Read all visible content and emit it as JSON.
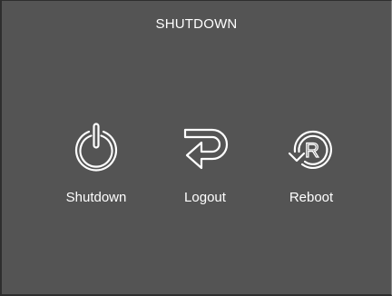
{
  "dialog": {
    "title": "SHUTDOWN"
  },
  "options": [
    {
      "label": "Shutdown",
      "icon": "power-icon"
    },
    {
      "label": "Logout",
      "icon": "logout-icon"
    },
    {
      "label": "Reboot",
      "icon": "reboot-icon",
      "icon_letter": "R"
    }
  ],
  "colors": {
    "background": "#545454",
    "text": "#ffffff",
    "icon_stroke": "#ffffff"
  }
}
